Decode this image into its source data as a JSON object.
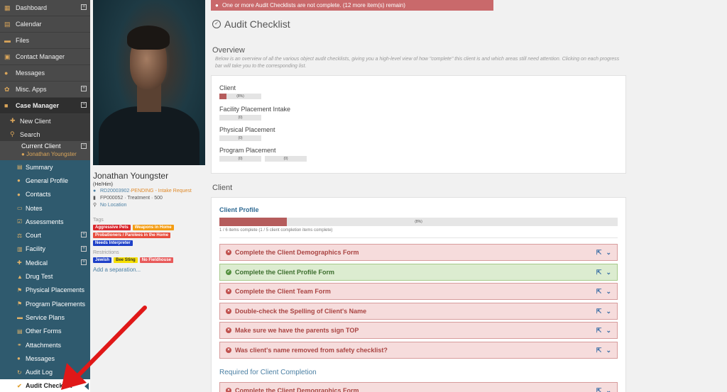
{
  "sidebar": {
    "top_items": [
      {
        "label": "Dashboard",
        "icon": "dashboard-icon",
        "glyph": "▦",
        "expand": true
      },
      {
        "label": "Calendar",
        "icon": "calendar-icon",
        "glyph": "▤",
        "expand": false
      },
      {
        "label": "Files",
        "icon": "folder-icon",
        "glyph": "▬",
        "expand": false
      },
      {
        "label": "Contact Manager",
        "icon": "contact-card-icon",
        "glyph": "▣",
        "expand": false
      },
      {
        "label": "Messages",
        "icon": "chat-bubbles-icon",
        "glyph": "●",
        "expand": false
      },
      {
        "label": "Misc. Apps",
        "icon": "cog-icon",
        "glyph": "✿",
        "expand": true
      },
      {
        "label": "Case Manager",
        "icon": "briefcase-icon",
        "glyph": "■",
        "expand": true
      }
    ],
    "case_items": [
      {
        "label": "New Client",
        "icon": "add-user-icon",
        "glyph": "✚"
      },
      {
        "label": "Search",
        "icon": "search-icon",
        "glyph": "⚲"
      }
    ],
    "current_client": {
      "label": "Current Client",
      "name": "Jonathan Youngster"
    },
    "client_items": [
      {
        "label": "Summary",
        "icon": "list-icon",
        "glyph": "▤",
        "expand": false
      },
      {
        "label": "General Profile",
        "icon": "user-icon",
        "glyph": "●",
        "expand": false
      },
      {
        "label": "Contacts",
        "icon": "users-icon",
        "glyph": "●",
        "expand": false
      },
      {
        "label": "Notes",
        "icon": "note-icon",
        "glyph": "▭",
        "expand": false
      },
      {
        "label": "Assessments",
        "icon": "checkbox-icon",
        "glyph": "☑",
        "expand": false
      },
      {
        "label": "Court",
        "icon": "gavel-icon",
        "glyph": "⚖",
        "expand": true
      },
      {
        "label": "Facility",
        "icon": "building-icon",
        "glyph": "▥",
        "expand": true
      },
      {
        "label": "Medical",
        "icon": "medical-kit-icon",
        "glyph": "✚",
        "expand": true
      },
      {
        "label": "Drug Test",
        "icon": "flask-icon",
        "glyph": "▲",
        "expand": false
      },
      {
        "label": "Physical Placements",
        "icon": "flag-icon",
        "glyph": "⚑",
        "expand": false
      },
      {
        "label": "Program Placements",
        "icon": "flag-icon",
        "glyph": "⚑",
        "expand": false
      },
      {
        "label": "Service Plans",
        "icon": "folder-icon",
        "glyph": "▬",
        "expand": false
      },
      {
        "label": "Other Forms",
        "icon": "list-icon",
        "glyph": "▤",
        "expand": false
      },
      {
        "label": "Attachments",
        "icon": "paperclip-icon",
        "glyph": "⚭",
        "expand": false
      },
      {
        "label": "Messages",
        "icon": "chat-bubbles-icon",
        "glyph": "●",
        "expand": false
      },
      {
        "label": "Audit Log",
        "icon": "refresh-icon",
        "glyph": "↻",
        "expand": false
      },
      {
        "label": "Audit Checklist",
        "icon": "check-circle-icon",
        "glyph": "✔",
        "expand": false,
        "active": true
      }
    ]
  },
  "profile": {
    "name": "Jonathan Youngster",
    "pronouns": "(He/Him)",
    "id": "RD20003902",
    "status": "PENDING",
    "status_sep": " · ",
    "status_detail": "- Intake Request",
    "file_line": "FP000052 · Treatment · 500",
    "location": "No Location",
    "tags_label": "Tags",
    "tags": [
      {
        "label": "Aggressive Pets",
        "color": "#d9262c"
      },
      {
        "label": "Weapons in Home",
        "color": "#f39c12"
      },
      {
        "label": "Probationers / Parolees in the Home",
        "color": "#e74c3c"
      },
      {
        "label": "Needs Interpreter",
        "color": "#1e40c8"
      }
    ],
    "restrictions_label": "Restrictions",
    "restrictions": [
      {
        "label": "Jewish",
        "color": "#1e40c8",
        "text": "#ffffff"
      },
      {
        "label": "Bee Sting",
        "color": "#f7e000",
        "text": "#333333"
      },
      {
        "label": "No Fieldhouse",
        "color": "#e85a5a",
        "text": "#ffffff"
      }
    ],
    "add_separation": "Add a separation..."
  },
  "alert": {
    "text": "One or more Audit Checklists are not complete. (12 more item(s) remain)"
  },
  "page_title": "Audit Checklist",
  "overview": {
    "heading": "Overview",
    "description": "Below is an overview of all the various object audit checklists, giving you a high-level view of how \"complete\" this client is and which areas still need attention. Clicking on each progress bar will take you to the corresponding list.",
    "rows": [
      {
        "label": "Client",
        "bars": [
          {
            "text": "(8%)",
            "progress": 0.17
          }
        ]
      },
      {
        "label": "Facility Placement Intake",
        "bars": [
          {
            "text": "(0)",
            "progress": 0
          }
        ]
      },
      {
        "label": "Physical Placement",
        "bars": [
          {
            "text": "(0)",
            "progress": 0
          }
        ]
      },
      {
        "label": "Program Placement",
        "bars": [
          {
            "text": "(0)",
            "progress": 0
          },
          {
            "text": "(0)",
            "progress": 0
          }
        ]
      }
    ]
  },
  "client_section": {
    "heading": "Client",
    "profile_title": "Client Profile",
    "progress_text": "(8%)",
    "progress": 0.17,
    "count": "1 / 6 items complete (1 / 5 client completion items complete)",
    "tasks": [
      {
        "label": "Complete the Client Demographics Form",
        "done": false
      },
      {
        "label": "Complete the Client Profile Form",
        "done": true
      },
      {
        "label": "Complete the Client Team Form",
        "done": false
      },
      {
        "label": "Double-check the Spelling of Client's Name",
        "done": false
      },
      {
        "label": "Make sure we have the parents sign TOP",
        "done": false
      },
      {
        "label": "Was client's name removed from safety checklist?",
        "done": false
      }
    ],
    "required_title": "Required for Client Completion",
    "required_tasks": [
      {
        "label": "Complete the Client Demographics Form",
        "done": false
      }
    ]
  },
  "colors": {
    "sidebar": "#4a4a4a",
    "client_menu": "#2f5a6e",
    "accent": "#d9a55a",
    "danger_bg": "#f6dcdc",
    "success_bg": "#dcecd0",
    "arrow": "#e01818"
  }
}
